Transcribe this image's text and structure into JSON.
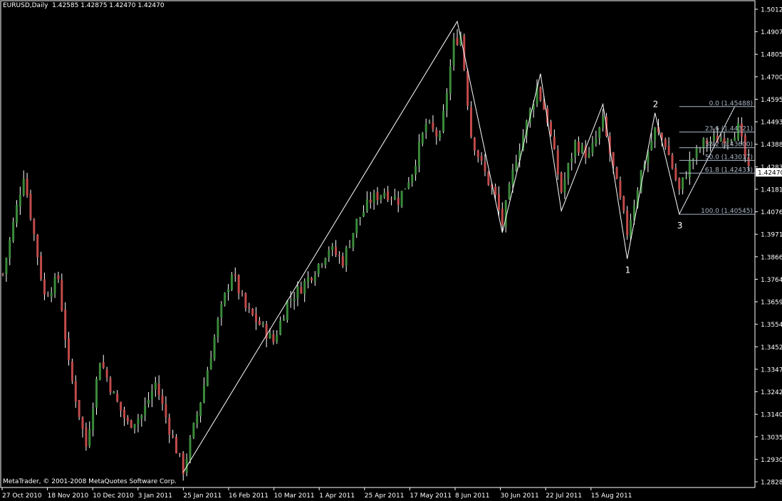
{
  "header": {
    "symbol": "EURUSD,Daily",
    "ohlc": "1.42585 1.42875 1.42470 1.42470"
  },
  "footer": {
    "copyright": "MetaTrader, © 2001-2008 MetaQuotes Software Corp."
  },
  "colors": {
    "background": "#000000",
    "grid": "#ffffff",
    "text": "#ffffff",
    "bull": "#3a8a3a",
    "bear": "#c24a4a",
    "wick": "#ffffff",
    "zigzag": "#ffffff",
    "fibo": "#a9b7c6",
    "price_tag_bg": "#ffffff",
    "price_tag_text": "#000000"
  },
  "chart_data": {
    "type": "candlestick",
    "symbol": "EURUSD",
    "timeframe": "Daily",
    "last_price": "1.42470",
    "y_ticks": [
      "1.50120",
      "1.49070",
      "1.48050",
      "1.47000",
      "1.45950",
      "1.44930",
      "1.43880",
      "1.42830",
      "1.41810",
      "1.40760",
      "1.39710",
      "1.38660",
      "1.37640",
      "1.36590",
      "1.35540",
      "1.34520",
      "1.33470",
      "1.32420",
      "1.31400",
      "1.30350",
      "1.29300",
      "1.28280"
    ],
    "ylim": [
      1.28,
      1.5035
    ],
    "x_ticks": [
      "27 Oct 2010",
      "18 Nov 2010",
      "10 Dec 2010",
      "3 Jan 2011",
      "25 Jan 2011",
      "16 Feb 2011",
      "10 Mar 2011",
      "1 Apr 2011",
      "25 Apr 2011",
      "17 May 2011",
      "8 Jun 2011",
      "30 Jun 2011",
      "22 Jul 2011",
      "15 Aug 2011"
    ],
    "bar_count": 216,
    "zigzag": [
      {
        "bar": 52,
        "price": 1.287
      },
      {
        "bar": 131,
        "price": 1.494
      },
      {
        "bar": 144,
        "price": 1.397
      },
      {
        "bar": 155,
        "price": 1.47
      },
      {
        "bar": 161,
        "price": 1.407
      },
      {
        "bar": 173,
        "price": 1.456
      },
      {
        "bar": 180,
        "price": 1.385
      },
      {
        "bar": 188,
        "price": 1.452
      },
      {
        "bar": 195,
        "price": 1.4055
      },
      {
        "bar": 211,
        "price": 1.4549
      }
    ],
    "point_labels": [
      {
        "text": "1",
        "bar": 180,
        "price": 1.385,
        "pos": "below"
      },
      {
        "text": "2",
        "bar": 188,
        "price": 1.452,
        "pos": "above"
      },
      {
        "text": "3",
        "bar": 195,
        "price": 1.4055,
        "pos": "below"
      }
    ],
    "fibonacci": {
      "from_bar": 195,
      "to_bar": 216,
      "levels": [
        {
          "label": "0.0 (1.45488)",
          "price": 1.45488
        },
        {
          "label": "23.6 (1.44321)",
          "price": 1.44321
        },
        {
          "label": "38.2 (1.43600)",
          "price": 1.436
        },
        {
          "label": "50.0 (1.43017)",
          "price": 1.43017
        },
        {
          "label": "61.8 (1.42433)",
          "price": 1.42433
        },
        {
          "label": "100.0 (1.40545)",
          "price": 1.40545
        }
      ]
    },
    "path": [
      [
        0,
        1.378
      ],
      [
        6,
        1.424
      ],
      [
        12,
        1.368
      ],
      [
        16,
        1.376
      ],
      [
        19,
        1.336
      ],
      [
        24,
        1.299
      ],
      [
        28,
        1.339
      ],
      [
        32,
        1.322
      ],
      [
        36,
        1.309
      ],
      [
        40,
        1.313
      ],
      [
        44,
        1.328
      ],
      [
        48,
        1.307
      ],
      [
        52,
        1.288
      ],
      [
        57,
        1.32
      ],
      [
        62,
        1.356
      ],
      [
        66,
        1.379
      ],
      [
        70,
        1.362
      ],
      [
        74,
        1.355
      ],
      [
        78,
        1.347
      ],
      [
        82,
        1.365
      ],
      [
        86,
        1.372
      ],
      [
        90,
        1.38
      ],
      [
        94,
        1.39
      ],
      [
        98,
        1.384
      ],
      [
        102,
        1.402
      ],
      [
        106,
        1.412
      ],
      [
        110,
        1.416
      ],
      [
        114,
        1.412
      ],
      [
        118,
        1.425
      ],
      [
        122,
        1.447
      ],
      [
        126,
        1.44
      ],
      [
        130,
        1.484
      ],
      [
        132,
        1.488
      ],
      [
        135,
        1.442
      ],
      [
        138,
        1.428
      ],
      [
        142,
        1.413
      ],
      [
        144,
        1.401
      ],
      [
        148,
        1.432
      ],
      [
        151,
        1.447
      ],
      [
        154,
        1.464
      ],
      [
        157,
        1.449
      ],
      [
        161,
        1.416
      ],
      [
        165,
        1.438
      ],
      [
        169,
        1.432
      ],
      [
        173,
        1.448
      ],
      [
        176,
        1.426
      ],
      [
        180,
        1.397
      ],
      [
        184,
        1.425
      ],
      [
        188,
        1.444
      ],
      [
        191,
        1.438
      ],
      [
        195,
        1.416
      ],
      [
        198,
        1.429
      ],
      [
        202,
        1.438
      ],
      [
        206,
        1.44
      ],
      [
        210,
        1.442
      ],
      [
        212,
        1.445
      ],
      [
        215,
        1.4247
      ]
    ]
  }
}
